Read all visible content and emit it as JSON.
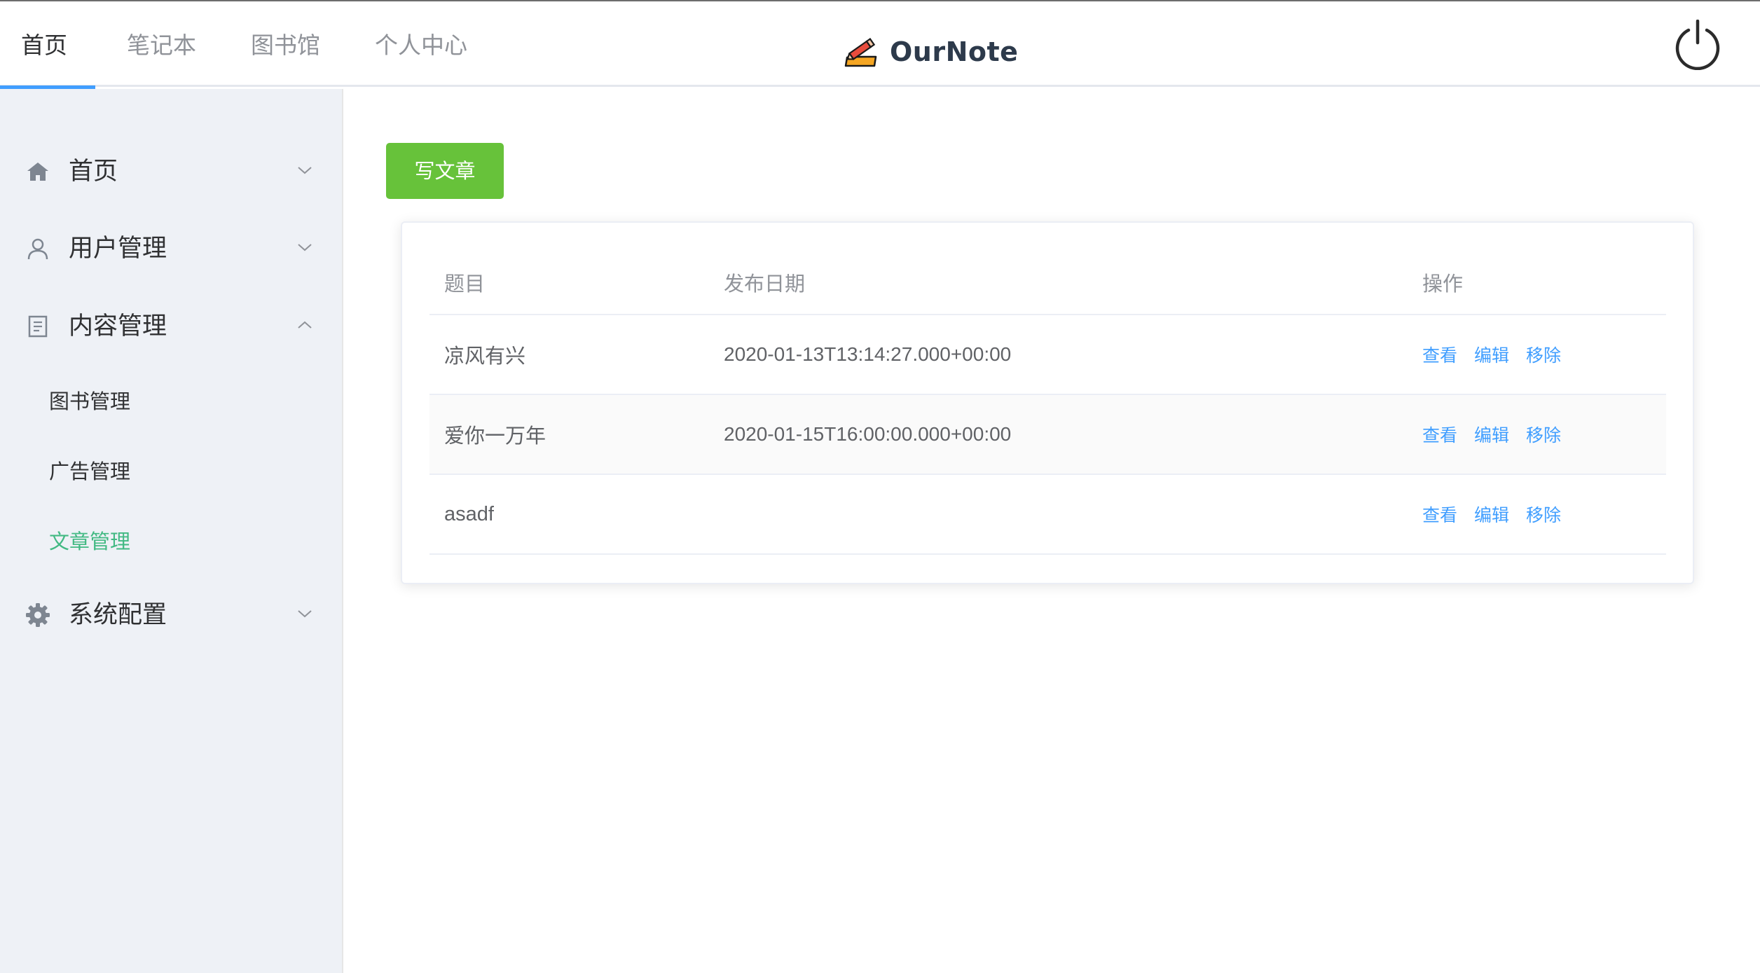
{
  "topnav": {
    "tabs": [
      {
        "label": "首页"
      },
      {
        "label": "笔记本"
      },
      {
        "label": "图书馆"
      },
      {
        "label": "个人中心"
      }
    ],
    "brand": "OurNote"
  },
  "sidebar": {
    "menus": [
      {
        "label": "首页",
        "icon": "home-icon"
      },
      {
        "label": "用户管理",
        "icon": "user-icon"
      },
      {
        "label": "内容管理",
        "icon": "document-icon"
      },
      {
        "label": "系统配置",
        "icon": "gear-icon"
      }
    ],
    "content_submenu": [
      {
        "label": "图书管理"
      },
      {
        "label": "广告管理"
      },
      {
        "label": "文章管理"
      }
    ]
  },
  "main": {
    "write_button": "写文章",
    "table": {
      "headers": {
        "title": "题目",
        "date": "发布日期",
        "ops": "操作"
      },
      "rows": [
        {
          "title": "凉风有兴",
          "date": "2020-01-13T13:14:27.000+00:00"
        },
        {
          "title": "爱你一万年",
          "date": "2020-01-15T16:00:00.000+00:00"
        },
        {
          "title": "asadf",
          "date": ""
        }
      ],
      "actions": {
        "view": "查看",
        "edit": "编辑",
        "remove": "移除"
      }
    }
  },
  "colors": {
    "accent": "#409eff",
    "primary_button": "#67c23a",
    "active_submenu": "#42b983",
    "sidebar_bg": "#eef1f6"
  }
}
